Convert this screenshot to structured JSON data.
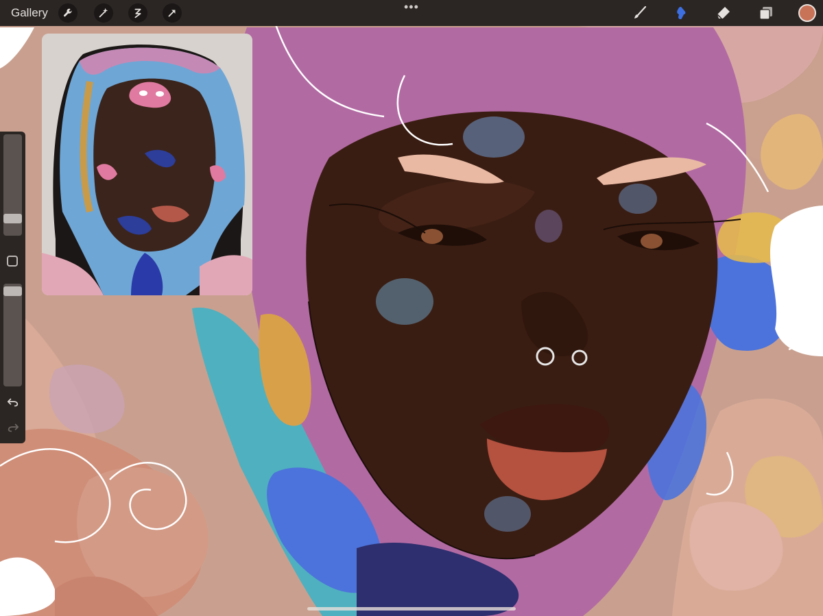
{
  "app": {
    "gallery_label": "Gallery",
    "more_glyph": "•••"
  },
  "toolbar_left": {
    "icons": [
      "wrench-icon",
      "magic-wand-icon",
      "selection-icon",
      "transform-arrow-icon"
    ]
  },
  "toolbar_right": {
    "icons": [
      "brush-icon",
      "smudge-icon",
      "eraser-icon",
      "layers-icon"
    ],
    "active_tool": "smudge",
    "current_color": "#c87258"
  },
  "sidebar": {
    "brush_size_level": 0.28,
    "opacity_level": 0.97,
    "controls": [
      "modifier-button",
      "undo-icon",
      "redo-icon"
    ]
  },
  "colors": {
    "toolbar_bg": "#2b2624",
    "accent_blue": "#3d6fe0",
    "skin_dark": "#3a1d12",
    "scarf_pink": "#b26aa3",
    "scarf_blue": "#4c73db",
    "scarf_teal": "#4fb0bf",
    "background_peach": "#c9a08f"
  }
}
